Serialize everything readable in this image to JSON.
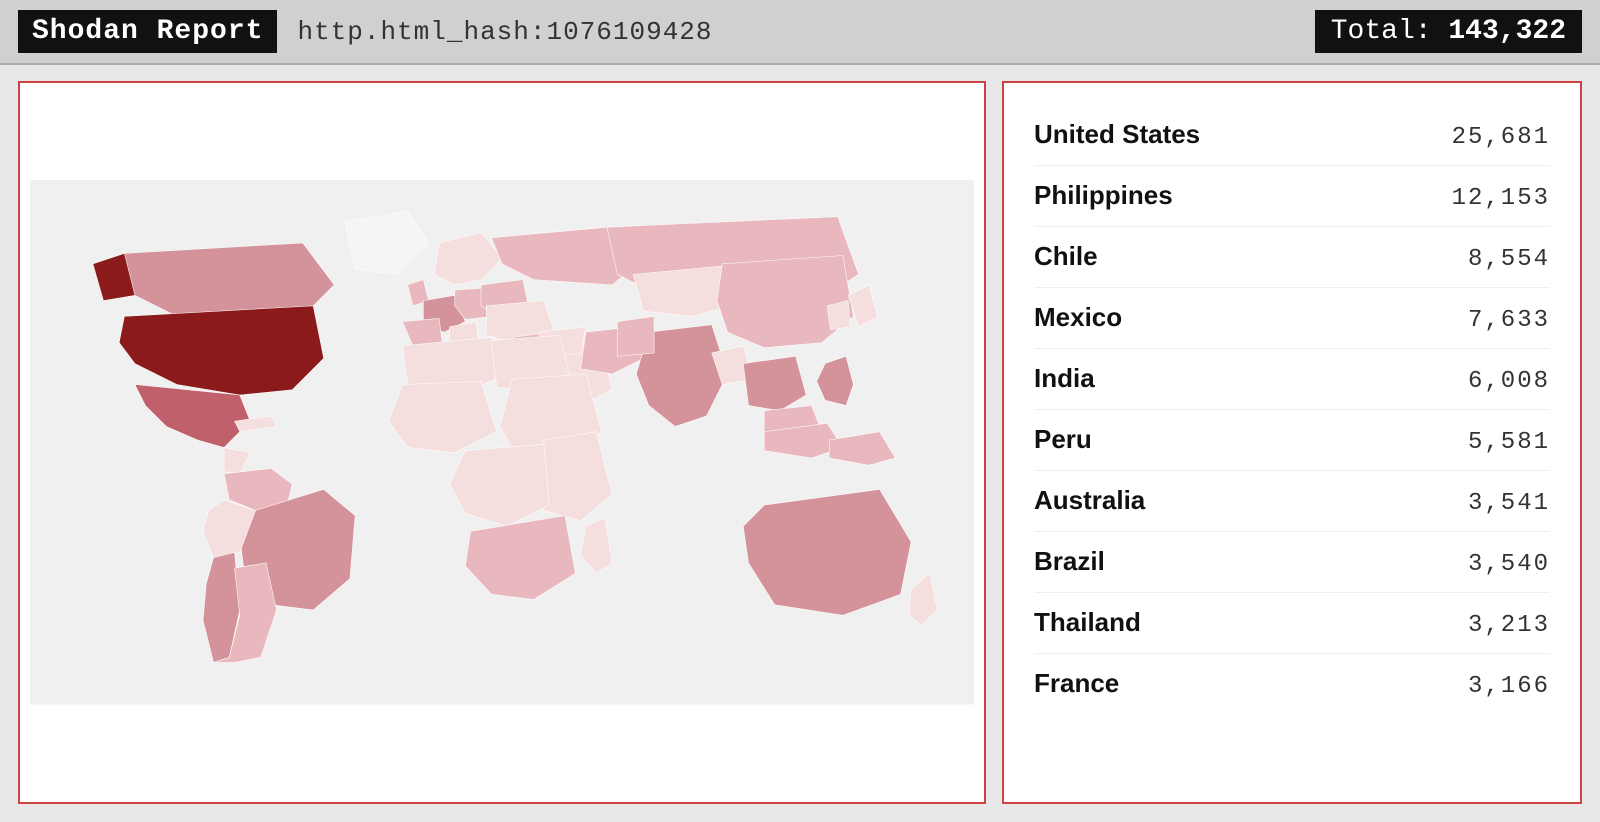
{
  "header": {
    "brand": "Shodan Report",
    "query": "http.html_hash:1076109428",
    "total_label": "Total:",
    "total_value": "143,322"
  },
  "countries": [
    {
      "name": "United States",
      "count": "25,681"
    },
    {
      "name": "Philippines",
      "count": "12,153"
    },
    {
      "name": "Chile",
      "count": "8,554"
    },
    {
      "name": "Mexico",
      "count": "7,633"
    },
    {
      "name": "India",
      "count": "6,008"
    },
    {
      "name": "Peru",
      "count": "5,581"
    },
    {
      "name": "Australia",
      "count": "3,541"
    },
    {
      "name": "Brazil",
      "count": "3,540"
    },
    {
      "name": "Thailand",
      "count": "3,213"
    },
    {
      "name": "France",
      "count": "3,166"
    }
  ],
  "colors": {
    "accent": "#c44444",
    "brand_bg": "#111111",
    "panel_border": "#cc4444"
  }
}
